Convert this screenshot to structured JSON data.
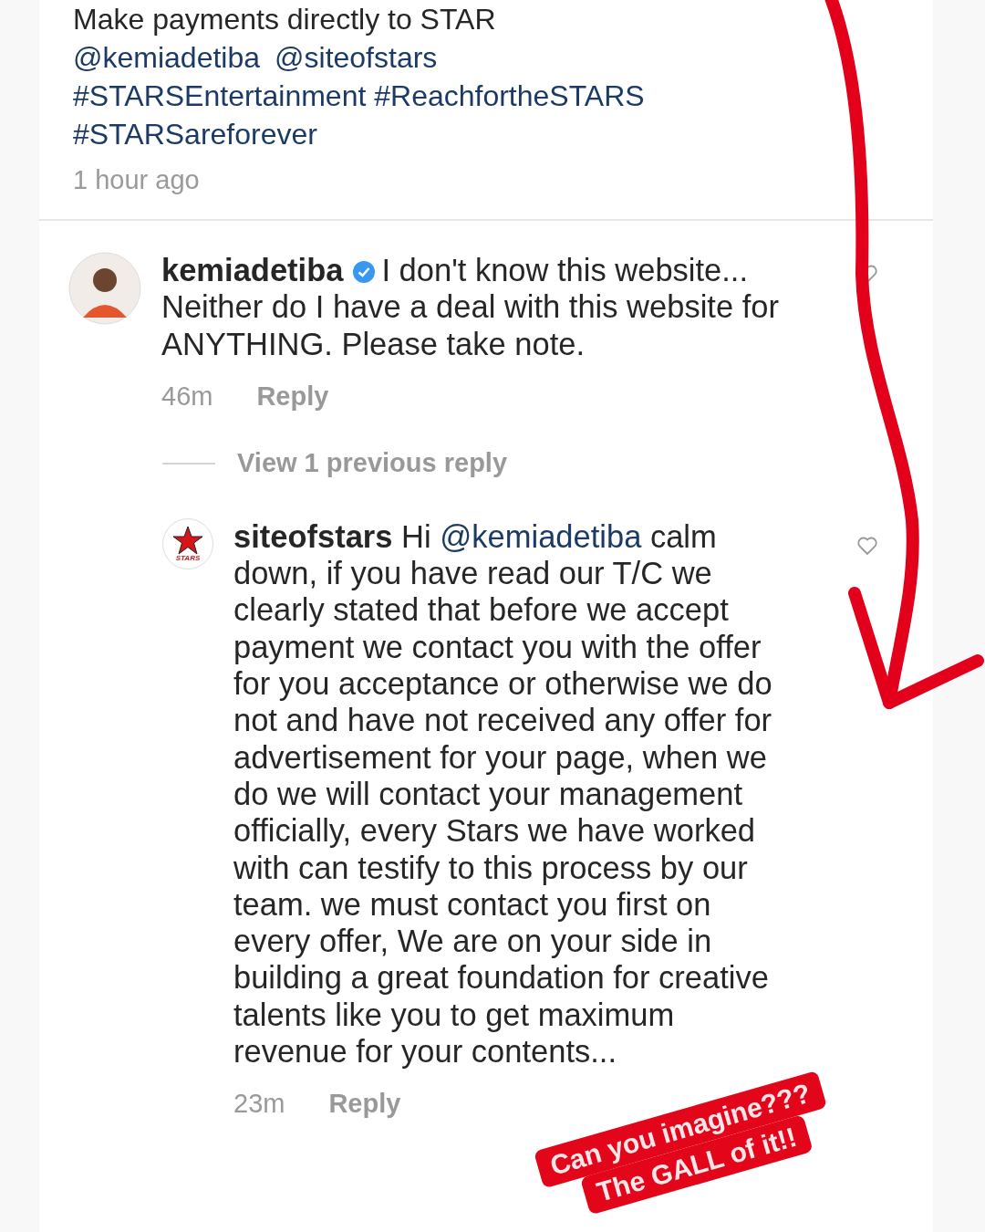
{
  "post": {
    "caption_tail": "Make payments directly to STAR",
    "mentions": [
      "@kemiadetiba",
      "@siteofstars"
    ],
    "hashtags": [
      "#STARSEntertainment #ReachfortheSTARS",
      "#STARSareforever"
    ],
    "time": "1 hour ago"
  },
  "comments": [
    {
      "kind": "comment",
      "username": "kemiadetiba",
      "verified": true,
      "parts": [
        {
          "kind": "text",
          "text": "I don't know this website... Neither do I have a deal with this website for ANYTHING. Please take note."
        }
      ],
      "time": "46m",
      "reply": "Reply",
      "liked": false
    },
    {
      "kind": "divider",
      "label": "View 1 previous reply"
    },
    {
      "kind": "reply",
      "logo_text": "STARS",
      "username": "siteofstars",
      "verified": false,
      "parts": [
        {
          "kind": "text",
          "text": "Hi"
        },
        {
          "kind": "mention",
          "text": "@kemiadetiba"
        },
        {
          "kind": "text",
          "text": "calm down, if you have read our T/C we clearly stated that before we accept payment we contact you with the offer for you acceptance or otherwise we do not and have not received any offer for advertisement for your page, when we do we will contact your management officially, every Stars we have worked with can testify to this process by our team. we must contact you first on every offer, We are on your side in building a great foundation for creative talents like you to get maximum revenue for your contents..."
        }
      ],
      "time": "23m",
      "reply": "Reply",
      "liked": false
    }
  ],
  "sticker": [
    "Can you imagine???",
    "The GALL of it!!"
  ]
}
